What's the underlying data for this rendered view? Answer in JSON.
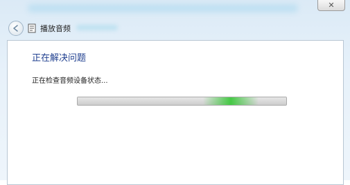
{
  "window": {
    "nav_title": "播放音频",
    "close_glyph": "✕"
  },
  "content": {
    "heading": "正在解决问题",
    "status": "正在检查音频设备状态...",
    "progress": {
      "value": 1.0,
      "mode": "indeterminate",
      "accent_color": "#3cc83c"
    }
  },
  "icons": {
    "back": "back-arrow-icon",
    "nav": "troubleshooter-icon",
    "close": "close-icon"
  },
  "colors": {
    "heading": "#1f3f8f",
    "glass": "#dbeaf6"
  }
}
